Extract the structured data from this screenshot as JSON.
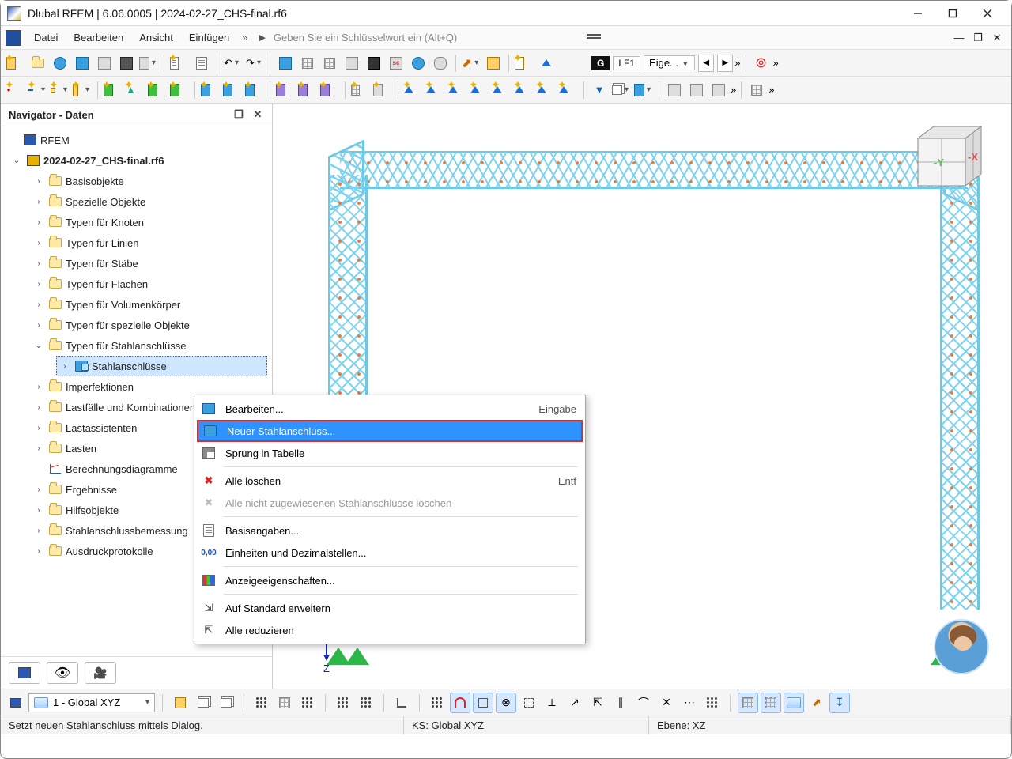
{
  "title": "Dlubal RFEM | 6.06.0005 | 2024-02-27_CHS-final.rf6",
  "menu": {
    "file": "Datei",
    "edit": "Bearbeiten",
    "view": "Ansicht",
    "insert": "Einfügen"
  },
  "search": {
    "placeholder": "Geben Sie ein Schlüsselwort ein (Alt+Q)"
  },
  "loadbox": {
    "g": "G",
    "lf": "LF1",
    "eige": "Eige..."
  },
  "navigator": {
    "title": "Navigator - Daten",
    "root": "RFEM",
    "file": "2024-02-27_CHS-final.rf6",
    "items": [
      "Basisobjekte",
      "Spezielle Objekte",
      "Typen für Knoten",
      "Typen für Linien",
      "Typen für Stäbe",
      "Typen für Flächen",
      "Typen für Volumenkörper",
      "Typen für spezielle Objekte",
      "Typen für Stahlanschlüsse",
      "Imperfektionen",
      "Lastfälle und Kombinationen",
      "Lastassistenten",
      "Lasten",
      "Berechnungsdiagramme",
      "Ergebnisse",
      "Hilfsobjekte",
      "Stahlanschlussbemessung",
      "Ausdruckprotokolle"
    ],
    "steel_child": "Stahlanschlüsse"
  },
  "context": {
    "edit": "Bearbeiten...",
    "edit_accel": "Eingabe",
    "new": "Neuer Stahlanschluss...",
    "jump": "Sprung in Tabelle",
    "delall": "Alle löschen",
    "delall_accel": "Entf",
    "delunassigned": "Alle nicht zugewiesenen Stahlanschlüsse löschen",
    "basedata": "Basisangaben...",
    "units": "Einheiten und Dezimalstellen...",
    "dispprops": "Anzeigeeigenschaften...",
    "expand": "Auf Standard erweitern",
    "collapse": "Alle reduzieren"
  },
  "canvas": {
    "zlabel": "Z",
    "cube_y": "-Y",
    "cube_x": "-X"
  },
  "bottom": {
    "combo": "1 - Global XYZ"
  },
  "status": {
    "hint": "Setzt neuen Stahlanschluss mittels Dialog.",
    "ks": "KS: Global XYZ",
    "ebene": "Ebene: XZ"
  }
}
